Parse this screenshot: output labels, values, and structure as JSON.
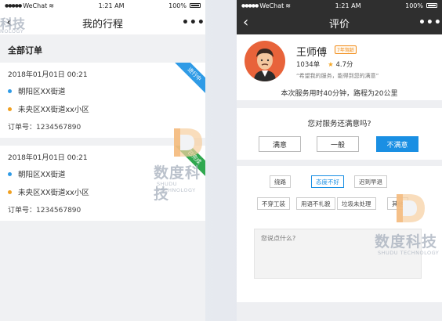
{
  "left": {
    "status": {
      "carrier": "WeChat",
      "time": "1:21 AM",
      "battery": "100%"
    },
    "nav": {
      "back": "‹",
      "title": "我的行程",
      "more": "•••"
    },
    "section_title": "全部订单",
    "trips": [
      {
        "time": "2018年01月01日  00:21",
        "from": "朝阳区XX街道",
        "to": "未央区XX街道xx小区",
        "order": "订单号：1234567890",
        "status": "进行中",
        "status_color": "#2f9be6"
      },
      {
        "time": "2018年01月01日  00:21",
        "from": "朝阳区XX街道",
        "to": "未央区XX街道xx小区",
        "order": "订单号：1234567890",
        "status": "已完成",
        "status_color": "#2fa84f"
      }
    ],
    "dot_colors": {
      "from": "#2f9be6",
      "to": "#f0a020"
    }
  },
  "right": {
    "status": {
      "carrier": "WeChat",
      "time": "1:21 AM",
      "battery": "100%"
    },
    "nav": {
      "back": "‹",
      "title": "评价",
      "more": "•••"
    },
    "driver": {
      "name": "王师傅",
      "badge": "7年驾龄",
      "orders": "1034单",
      "rating": "4.7分",
      "star": "★",
      "quote": "“希望我的服务，能得到您的满意”"
    },
    "service_summary": "本次服务用时40分钟，路程为20公里",
    "question": "您对服务还满意吗?",
    "choices": [
      "满意",
      "一般",
      "不满意"
    ],
    "tags": [
      "绕路",
      "态度不好",
      "迟到早退",
      "不穿工装",
      "用语不礼貌",
      "垃圾未处理",
      "其他"
    ],
    "comment_placeholder": "您说点什么?"
  },
  "watermark": {
    "brand": "数度科技",
    "sub": "SHUDU TECHNOLOGY",
    "corner": "科技",
    "corner_sub": "NOLOGY"
  },
  "colors": {
    "accent": "#1a8fe3",
    "dark_bar": "#2f2f2f"
  }
}
